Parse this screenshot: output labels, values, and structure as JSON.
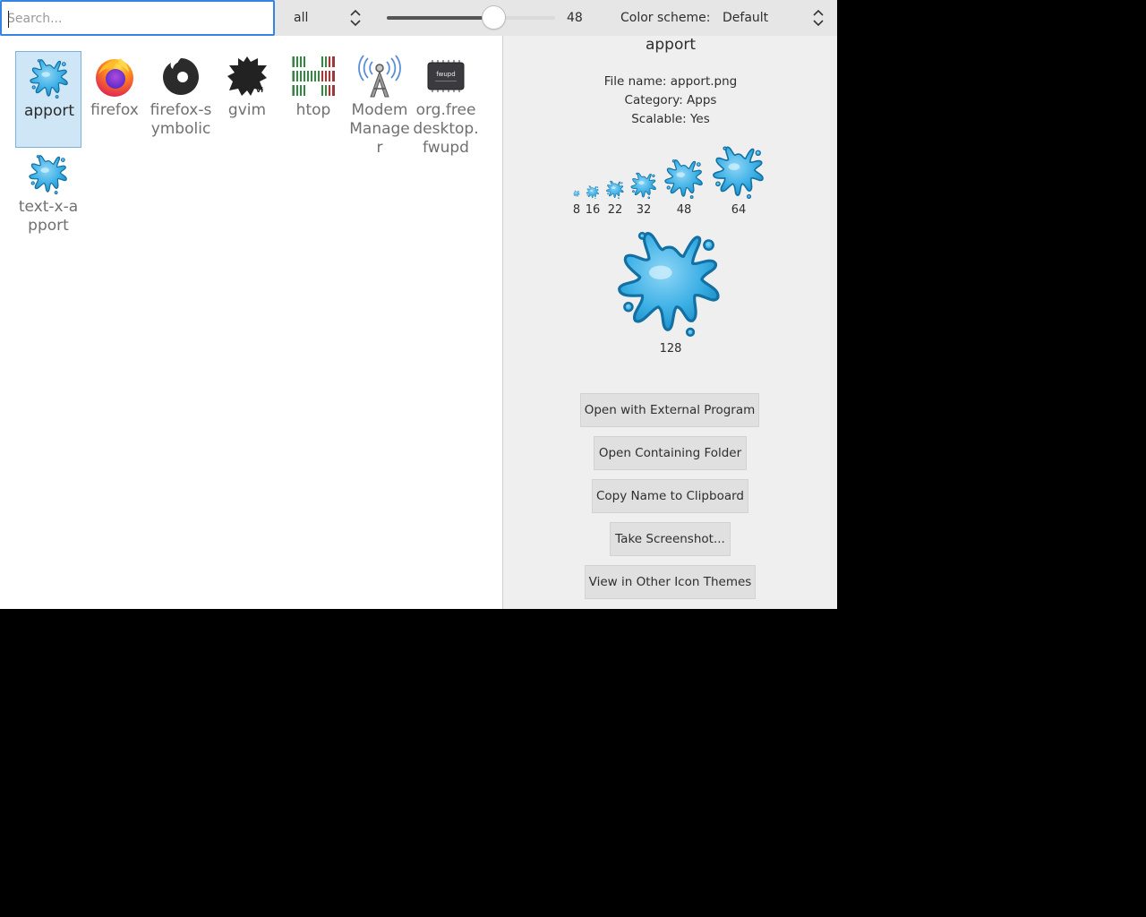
{
  "toolbar": {
    "search_placeholder": "Search...",
    "filter_value": "all",
    "icon_size": "48",
    "icon_size_fraction": 0.64,
    "color_scheme_label": "Color scheme:",
    "color_scheme_value": "Default"
  },
  "icons": [
    {
      "label": "apport",
      "icon": "apport-splash-icon",
      "selected": true
    },
    {
      "label": "firefox",
      "icon": "firefox-icon"
    },
    {
      "label": "firefox-symbolic",
      "icon": "firefox-symbolic-icon"
    },
    {
      "label": "gvim",
      "icon": "gvim-icon"
    },
    {
      "label": "htop",
      "icon": "htop-icon"
    },
    {
      "label": "ModemManager",
      "icon": "modem-tower-icon"
    },
    {
      "label": "org.freedesktop.fwupd",
      "icon": "fwupd-chip-icon"
    },
    {
      "label": "text-x-apport",
      "icon": "apport-splash-icon"
    }
  ],
  "details": {
    "title": "apport",
    "file_name": "File name: apport.png",
    "category": "Category: Apps",
    "scalable": "Scalable: Yes",
    "sizes": [
      "8",
      "16",
      "22",
      "32",
      "48",
      "64",
      "128"
    ],
    "buttons": {
      "open_external": "Open with External Program",
      "open_folder": "Open Containing Folder",
      "copy_name": "Copy Name to Clipboard",
      "screenshot": "Take Screenshot...",
      "other_themes": "View in Other Icon Themes"
    }
  },
  "colors": {
    "accent": "#3584e4",
    "selection": "#cfe6f7",
    "splash": "#3db0e6"
  }
}
